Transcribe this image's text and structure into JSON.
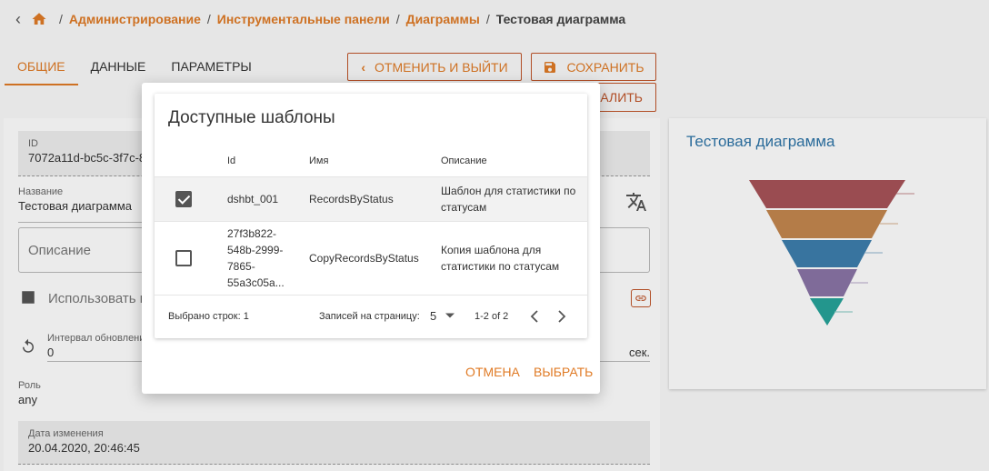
{
  "breadcrumb": {
    "back_icon": "chevron-left-icon",
    "home_icon": "home-icon",
    "items": [
      "Администрирование",
      "Инструментальные панели",
      "Диаграммы"
    ],
    "current": "Тестовая диаграмма",
    "separator": "/"
  },
  "tabs": [
    "ОБЩИЕ",
    "ДАННЫЕ",
    "ПАРАМЕТРЫ"
  ],
  "toolbar": {
    "cancel_exit": "ОТМЕНИТЬ И ВЫЙТИ",
    "save": "СОХРАНИТЬ",
    "delete": "АЛИТЬ"
  },
  "form": {
    "id_label": "ID",
    "id_value": "7072a11d-bc5c-3f7c-8",
    "name_label": "Название",
    "name_value": "Тестовая диаграмма",
    "description_placeholder": "Описание",
    "use_template": "Использовать ш",
    "interval_label": "Интервал обновлени",
    "interval_value": "0",
    "interval_unit": "сек.",
    "role_label": "Роль",
    "role_value": "any",
    "modified_label": "Дата изменения",
    "modified_value": "20.04.2020, 20:46:45"
  },
  "chart_card": {
    "title": "Тестовая диаграмма"
  },
  "dialog": {
    "title": "Доступные шаблоны",
    "columns": [
      "Id",
      "Имя",
      "Описание"
    ],
    "rows": [
      {
        "checked": true,
        "id": "dshbt_001",
        "name": "RecordsByStatus",
        "description_1": "Шаблон для статистики по",
        "description_2": "статусам"
      },
      {
        "checked": false,
        "id_lines": [
          "27f3b822-",
          "548b-2999-",
          "7865-",
          "55a3c05a..."
        ],
        "name": "CopyRecordsByStatus",
        "description_1": "Копия шаблона для",
        "description_2": "статистики по статусам"
      }
    ],
    "footer": {
      "selected": "Выбрано строк: 1",
      "per_page_label": "Записей на страницу:",
      "per_page_value": "5",
      "range": "1-2 of 2"
    },
    "cancel": "ОТМЕНА",
    "select": "ВЫБРАТЬ"
  },
  "colors": {
    "accent": "#e07b26",
    "funnel": [
      "#a85358",
      "#c4874f",
      "#3d7ead",
      "#8a75a6",
      "#27a39a"
    ]
  }
}
